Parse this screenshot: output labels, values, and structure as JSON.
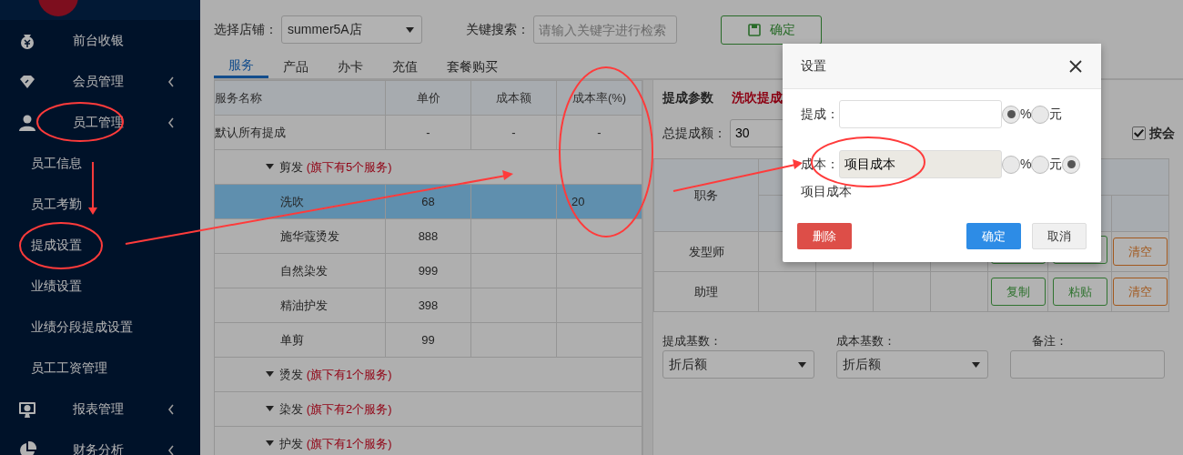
{
  "sidebar": {
    "items": [
      {
        "label": "前台收银",
        "has_submenu": false
      },
      {
        "label": "会员管理",
        "has_submenu": true
      },
      {
        "label": "员工管理",
        "has_submenu": true,
        "children": [
          {
            "label": "员工信息"
          },
          {
            "label": "员工考勤"
          },
          {
            "label": "提成设置"
          },
          {
            "label": "业绩设置"
          },
          {
            "label": "业绩分段提成设置"
          },
          {
            "label": "员工工资管理"
          }
        ]
      },
      {
        "label": "报表管理",
        "has_submenu": true
      },
      {
        "label": "财务分析",
        "has_submenu": true
      }
    ]
  },
  "toolbar": {
    "store_label": "选择店铺：",
    "store_value": "summer5A店",
    "search_label": "关键搜索：",
    "search_placeholder": "请输入关键字进行检索",
    "confirm_button": "确定"
  },
  "tabs": [
    {
      "label": "服务",
      "selected": true
    },
    {
      "label": "产品",
      "selected": false
    },
    {
      "label": "办卡",
      "selected": false
    },
    {
      "label": "充值",
      "selected": false
    },
    {
      "label": "套餐购买",
      "selected": false
    }
  ],
  "service_table": {
    "columns": [
      "服务名称",
      "单价",
      "成本额",
      "成本率(%)"
    ],
    "rows": [
      {
        "kind": "row",
        "indent": false,
        "selected": false,
        "cells": [
          "默认所有提成",
          "-",
          "-",
          "-"
        ]
      },
      {
        "kind": "group",
        "name": "剪发",
        "note": "(旗下有5个服务)"
      },
      {
        "kind": "row",
        "indent": true,
        "selected": true,
        "cells": [
          "洗吹",
          "68",
          "",
          "20"
        ]
      },
      {
        "kind": "row",
        "indent": true,
        "selected": false,
        "cells": [
          "施华蔻烫发",
          "888",
          "",
          ""
        ]
      },
      {
        "kind": "row",
        "indent": true,
        "selected": false,
        "cells": [
          "自然染发",
          "999",
          "",
          ""
        ]
      },
      {
        "kind": "row",
        "indent": true,
        "selected": false,
        "cells": [
          "精油护发",
          "398",
          "",
          ""
        ]
      },
      {
        "kind": "row",
        "indent": true,
        "selected": false,
        "cells": [
          "单剪",
          "99",
          "",
          ""
        ]
      },
      {
        "kind": "group",
        "name": "烫发",
        "note": "(旗下有1个服务)"
      },
      {
        "kind": "group",
        "name": "染发",
        "note": "(旗下有2个服务)"
      },
      {
        "kind": "group",
        "name": "护发",
        "note": "(旗下有1个服务)"
      }
    ]
  },
  "params": {
    "title": "提成参数",
    "subtitle": "洗吹提成",
    "total_label": "总提成额：",
    "total_value": "30",
    "member_checkbox": {
      "label": "按会",
      "checked": true
    },
    "role_table": {
      "column": "职务",
      "rows": [
        {
          "role": "发型师",
          "actions": [
            {
              "kind": "copy"
            },
            {
              "kind": "paste"
            },
            {
              "kind": "clear",
              "label": "清空"
            }
          ]
        },
        {
          "role": "助理",
          "actions": [
            {
              "kind": "copy",
              "label": "复制"
            },
            {
              "kind": "paste",
              "label": "粘贴"
            },
            {
              "kind": "clear",
              "label": "清空"
            }
          ]
        }
      ]
    },
    "commission_base": {
      "label": "提成基数：",
      "value": "折后额"
    },
    "cost_base": {
      "label": "成本基数：",
      "value": "折后额"
    },
    "remark": {
      "label": "备注："
    }
  },
  "dialog": {
    "title": "设置",
    "fields": [
      {
        "label": "提成：",
        "readonly": false,
        "options": [
          {
            "label": "%",
            "selected": true
          },
          {
            "label": "元",
            "selected": false
          }
        ]
      },
      {
        "label": "成本：",
        "value": "项目成本",
        "readonly": true,
        "options": [
          {
            "label": "%",
            "selected": false
          },
          {
            "label": "元",
            "selected": false
          },
          {
            "selected": true
          }
        ],
        "hint": "项目成本"
      }
    ],
    "buttons": [
      {
        "label": "删除",
        "kind": "danger"
      },
      {
        "label": "确定",
        "kind": "primary"
      },
      {
        "label": "取消",
        "kind": "default"
      }
    ]
  }
}
